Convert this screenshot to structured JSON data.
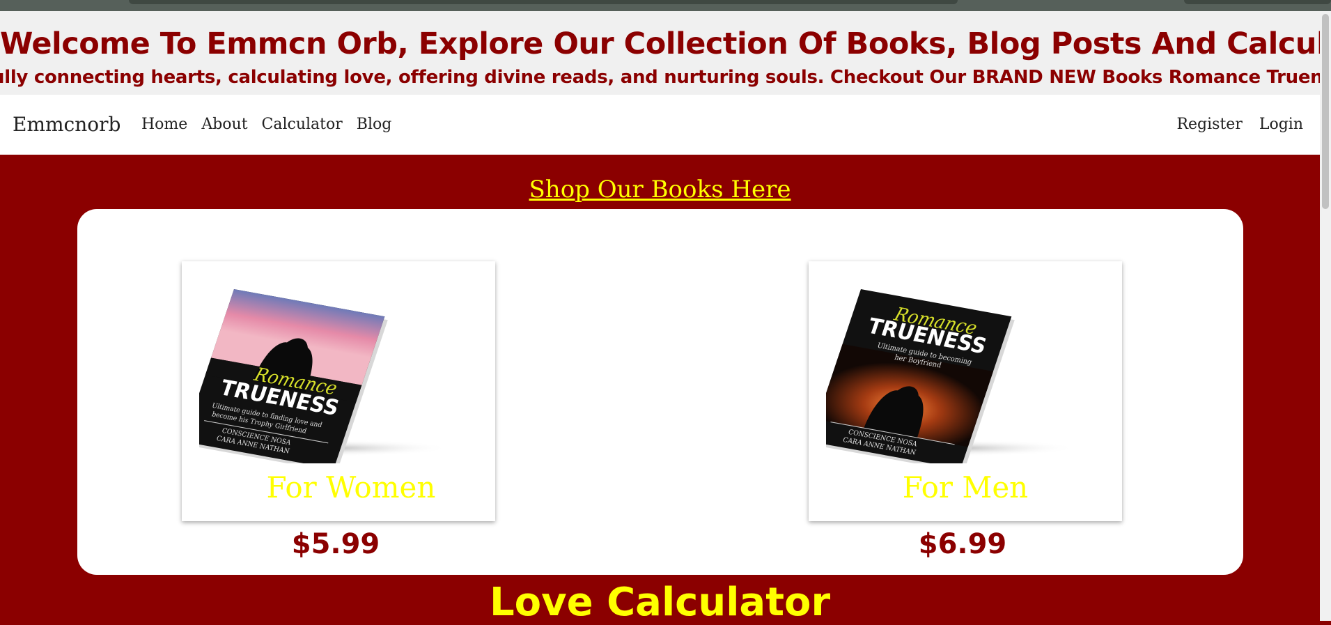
{
  "banner": {
    "title": "Welcome To Emmcn Orb, Explore Our Collection Of Books, Blog Posts And Calculator",
    "marquee": "ully connecting hearts, calculating love, offering divine reads, and nurturing souls. Checkout Our BRAND NEW Books Romance Trueness®"
  },
  "navbar": {
    "brand": "Emmcnorb",
    "links": [
      "Home",
      "About",
      "Calculator",
      "Blog"
    ],
    "right": [
      "Register",
      "Login"
    ]
  },
  "shop": {
    "link_text": "Shop Our Books Here",
    "books": [
      {
        "label": "For Women",
        "price": "$5.99",
        "cover": {
          "script_title": "Romance",
          "title": "TRUENESS",
          "subtitle_1": "Ultimate guide to finding love and",
          "subtitle_2": "become his Trophy Girlfriend",
          "author_1": "CONSCIENCE NOSA",
          "author_2": "CARA ANNE NATHAN"
        }
      },
      {
        "label": "For Men",
        "price": "$6.99",
        "cover": {
          "script_title": "Romance",
          "title": "TRUENESS",
          "subtitle_1": "Ultimate guide to becoming",
          "subtitle_2": "her Boyfriend",
          "author_1": "CONSCIENCE NOSA",
          "author_2": "CARA ANNE NATHAN"
        }
      }
    ]
  },
  "calculator": {
    "title": "Love Calculator"
  },
  "colors": {
    "brand_red": "#8b0000",
    "accent_yellow": "#ffff00",
    "banner_bg": "#f0f0f0"
  }
}
